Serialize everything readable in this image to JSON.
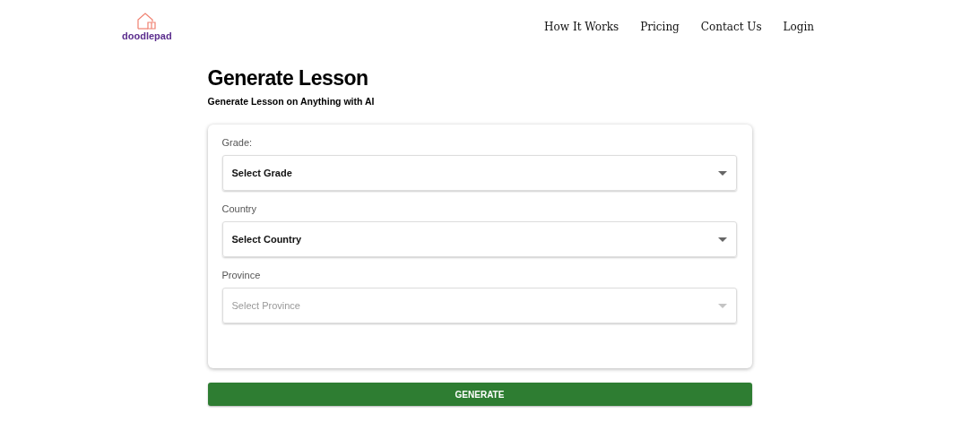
{
  "logo": {
    "text": "doodlepad"
  },
  "nav": [
    "How It Works",
    "Pricing",
    "Contact Us",
    "Login"
  ],
  "heading": "Generate Lesson",
  "subheading": "Generate Lesson on Anything with AI",
  "fields": [
    {
      "label": "Grade:",
      "placeholder": "Select Grade",
      "disabled": false
    },
    {
      "label": "Country",
      "placeholder": "Select Country",
      "disabled": false
    },
    {
      "label": "Province",
      "placeholder": "Select Province",
      "disabled": true
    }
  ],
  "button": "GENERATE"
}
